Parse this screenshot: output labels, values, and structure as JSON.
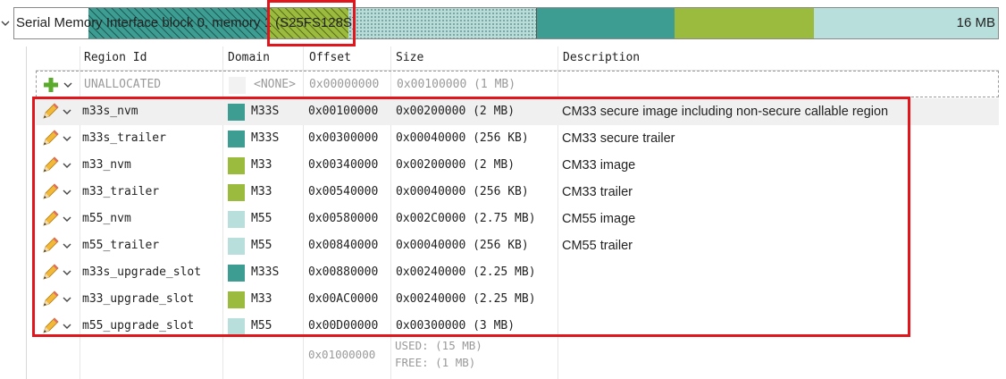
{
  "memory_bar": {
    "label": "Serial Memory Interface block 0, memory 1 (S25FS128S)",
    "size": "16 MB",
    "icons": {
      "collapse": "chevron-down-icon"
    }
  },
  "table": {
    "headers": {
      "region_id": "Region Id",
      "domain": "Domain",
      "offset": "Offset",
      "size": "Size",
      "description": "Description"
    },
    "unallocated": {
      "icon": "plus-icon",
      "region_id": "UNALLOCATED",
      "domain": "<NONE>",
      "offset": "0x00000000",
      "size": "0x00100000 (1 MB)"
    },
    "rows": [
      {
        "region_id": "m33s_nvm",
        "domain": "M33S",
        "color": "#3d9d92",
        "offset": "0x00100000",
        "size": "0x00200000 (2 MB)",
        "description": "CM33 secure image including non-secure callable region"
      },
      {
        "region_id": "m33s_trailer",
        "domain": "M33S",
        "color": "#3d9d92",
        "offset": "0x00300000",
        "size": "0x00040000 (256 KB)",
        "description": "CM33 secure trailer"
      },
      {
        "region_id": "m33_nvm",
        "domain": "M33",
        "color": "#9bbb3e",
        "offset": "0x00340000",
        "size": "0x00200000 (2 MB)",
        "description": "CM33 image"
      },
      {
        "region_id": "m33_trailer",
        "domain": "M33",
        "color": "#9bbb3e",
        "offset": "0x00540000",
        "size": "0x00040000 (256 KB)",
        "description": "CM33 trailer"
      },
      {
        "region_id": "m55_nvm",
        "domain": "M55",
        "color": "#b8dfdc",
        "offset": "0x00580000",
        "size": "0x002C0000 (2.75 MB)",
        "description": "CM55 image"
      },
      {
        "region_id": "m55_trailer",
        "domain": "M55",
        "color": "#b8dfdc",
        "offset": "0x00840000",
        "size": "0x00040000 (256 KB)",
        "description": "CM55 trailer"
      },
      {
        "region_id": "m33s_upgrade_slot",
        "domain": "M33S",
        "color": "#3d9d92",
        "offset": "0x00880000",
        "size": "0x00240000 (2.25 MB)",
        "description": ""
      },
      {
        "region_id": "m33_upgrade_slot",
        "domain": "M33",
        "color": "#9bbb3e",
        "offset": "0x00AC0000",
        "size": "0x00240000 (2.25 MB)",
        "description": ""
      },
      {
        "region_id": "m55_upgrade_slot",
        "domain": "M55",
        "color": "#b8dfdc",
        "offset": "0x00D00000",
        "size": "0x00300000 (3 MB)",
        "description": ""
      }
    ],
    "row_icons": {
      "edit": "pencil-icon",
      "menu": "chevron-down-icon"
    },
    "summary": {
      "offset": "0x01000000",
      "used": "USED: (15 MB)",
      "free": "FREE: (1 MB)"
    }
  }
}
